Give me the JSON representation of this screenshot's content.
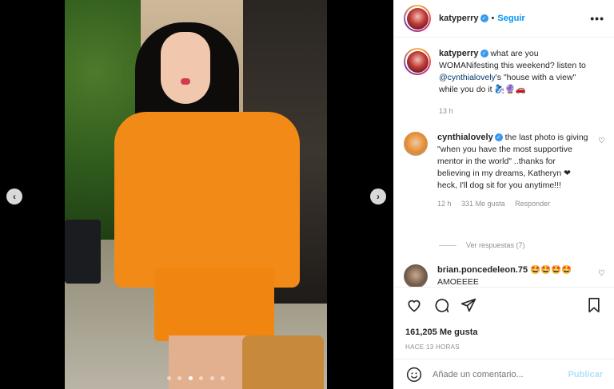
{
  "post": {
    "author": "katyperry",
    "follow_label": "Seguir",
    "separator": "•",
    "more_icon": "•••"
  },
  "media": {
    "prev_icon": "‹",
    "next_icon": "›",
    "slide_count": 6,
    "active_slide": 3
  },
  "caption": {
    "username": "katyperry",
    "text_before": "what are you WOMANifesting this weekend? listen to ",
    "mention": "@cynthialovely",
    "text_after": "'s \"house with a view\" while you do it 🧞‍♀️🔮🚗",
    "time": "13 h"
  },
  "comments": [
    {
      "username": "cynthialovely",
      "text": "the last photo is giving \"when you have the most supportive mentor in the world\" ..thanks for believing in my dreams, Katheryn ❤ heck, I'll dog sit for you anytime!!!",
      "time": "12 h",
      "likes": "331 Me gusta",
      "reply": "Responder",
      "view_replies": "Ver respuestas (7)"
    },
    {
      "username": "brian.poncedeleon.75",
      "text": "🤩🤩🤩🤩 AMOEEEE"
    }
  ],
  "stats": {
    "likes": "161,205 Me gusta",
    "posted": "HACE 13 HORAS"
  },
  "add_comment": {
    "placeholder": "Añade un comentario...",
    "publish": "Publicar"
  },
  "colors": {
    "accent": "#0095f6",
    "verified": "#3897f0",
    "mention": "#00376b",
    "muted": "#8e8e8e"
  }
}
